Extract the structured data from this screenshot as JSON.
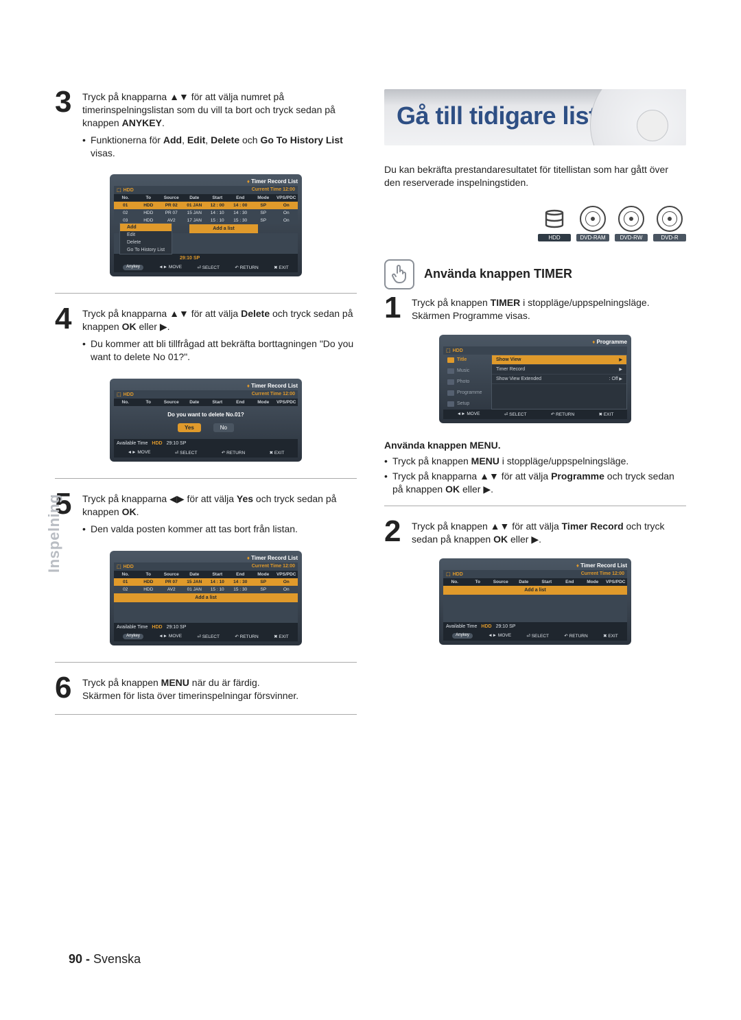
{
  "side_label": "Inspelning",
  "footer": {
    "page": "90 -",
    "lang": "Svenska"
  },
  "left": {
    "step3": {
      "num": "3",
      "text_a": "Tryck på knapparna ▲▼ för att välja numret på timerinspelningslistan som du vill ta bort och tryck sedan på knappen ",
      "text_b": "ANYKEY",
      "text_c": ".",
      "bullet1_a": "Funktionerna för ",
      "bullet1_b": "Add",
      "bullet1_c": ", ",
      "bullet1_d": "Edit",
      "bullet1_e": ", ",
      "bullet1_f": "Delete",
      "bullet1_g": " och ",
      "bullet1_h": "Go To History List",
      "bullet1_i": " visas."
    },
    "step4": {
      "num": "4",
      "text_a": "Tryck på knapparna ▲▼ för att välja ",
      "text_b": "Delete",
      "text_c": " och tryck sedan på knappen ",
      "text_d": "OK",
      "text_e": " eller ▶.",
      "bullet1": "Du kommer att bli tillfrågad att bekräfta borttagningen \"Do you want to delete No 01?\"."
    },
    "step5": {
      "num": "5",
      "text_a": "Tryck på knapparna ◀▶ för att välja ",
      "text_b": "Yes",
      "text_c": " och tryck sedan på knappen ",
      "text_d": "OK",
      "text_e": ".",
      "bullet1": "Den valda posten kommer att tas bort från listan."
    },
    "step6": {
      "num": "6",
      "text_a": "Tryck på knappen ",
      "text_b": "MENU",
      "text_c": " när du är färdig.",
      "line2": "Skärmen för lista över timerinspelningar försvinner."
    }
  },
  "right": {
    "banner_title": "Gå till tidigare lista",
    "intro": "Du kan bekräfta prestandaresultatet för titellistan som har gått över den reserverade inspelningstiden.",
    "disc_labels": [
      "HDD",
      "DVD-RAM",
      "DVD-RW",
      "DVD-R"
    ],
    "section_title": "Använda knappen TIMER",
    "step1": {
      "num": "1",
      "text_a": "Tryck på knappen ",
      "text_b": "TIMER",
      "text_c": " i stoppläge/uppspelningsläge.",
      "line2": "Skärmen Programme visas."
    },
    "menu_title": "Använda knappen MENU.",
    "menu_b1_a": "Tryck på knappen ",
    "menu_b1_b": "MENU",
    "menu_b1_c": " i stoppläge/uppspelningsläge.",
    "menu_b2_a": "Tryck på knapparna ▲▼ för att välja ",
    "menu_b2_b": "Programme",
    "menu_b2_c": " och tryck sedan på knappen ",
    "menu_b2_d": "OK",
    "menu_b2_e": " eller ▶.",
    "step2": {
      "num": "2",
      "text_a": "Tryck på knappen ▲▼ för att välja ",
      "text_b": "Timer Record",
      "text_c": " och tryck sedan på knappen ",
      "text_d": "OK",
      "text_e": " eller ▶."
    }
  },
  "osd_common": {
    "title_trl": "Timer Record List",
    "title_prog": "Programme",
    "device": "HDD",
    "cur_time_label": "Current Time 12:00",
    "headers": [
      "No.",
      "To",
      "Source",
      "Date",
      "Start",
      "End",
      "Mode",
      "VPS/PDC"
    ],
    "available_time": "Available Time",
    "avail_val": "29:10  SP",
    "hints": {
      "anykey": "Anykey",
      "move": "MOVE",
      "select": "SELECT",
      "return": "RETURN",
      "exit": "EXIT"
    }
  },
  "osd1": {
    "rows": [
      [
        "01",
        "HDD",
        "PR 02",
        "01 JAN",
        "12 : 00",
        "14 : 00",
        "SP",
        "On"
      ],
      [
        "02",
        "HDD",
        "PR 07",
        "15 JAN",
        "14 : 10",
        "14 : 30",
        "SP",
        "On"
      ],
      [
        "03",
        "HDD",
        "AV2",
        "17 JAN",
        "15 : 10",
        "15 : 30",
        "SP",
        "On"
      ]
    ],
    "menu": [
      "Add",
      "Edit",
      "Delete",
      "Go To History List"
    ],
    "addlist": "Add a list"
  },
  "osd2": {
    "confirm": "Do you want to delete No.01?",
    "yes": "Yes",
    "no": "No"
  },
  "osd3": {
    "rows": [
      [
        "01",
        "HDD",
        "PR 07",
        "15 JAN",
        "14 : 10",
        "14 : 30",
        "SP",
        "On"
      ],
      [
        "02",
        "HDD",
        "AV2",
        "01 JAN",
        "15 : 10",
        "15 : 30",
        "SP",
        "On"
      ]
    ],
    "addlist": "Add a list"
  },
  "osd4": {
    "side": [
      "Title",
      "Music",
      "Photo",
      "Programme",
      "Setup"
    ],
    "pane": [
      {
        "l": "Show View",
        "r": ""
      },
      {
        "l": "Timer Record",
        "r": ""
      },
      {
        "l": "Show View Extended",
        "r": ": Off"
      }
    ]
  },
  "osd5": {
    "addlist": "Add a list"
  }
}
